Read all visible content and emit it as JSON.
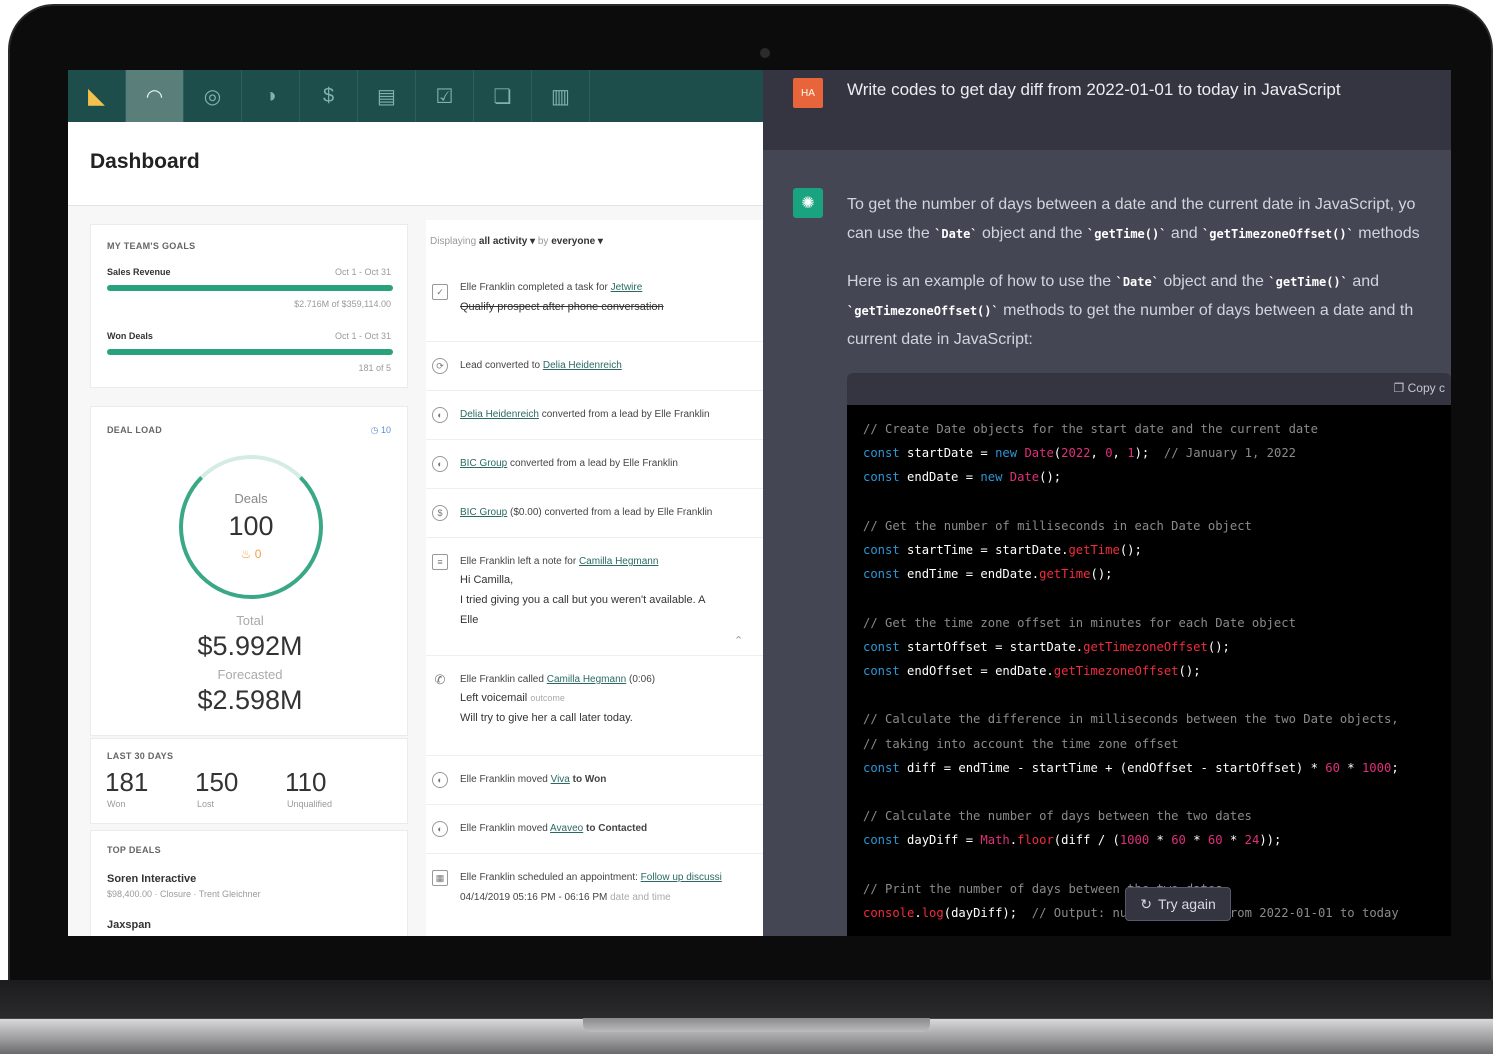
{
  "crm": {
    "title": "Dashboard",
    "goals": {
      "heading": "MY TEAM'S GOALS",
      "items": [
        {
          "label": "Sales Revenue",
          "range": "Oct 1 - Oct 31",
          "detail": "$2.716M of $359,114.00",
          "progress": 1.0
        },
        {
          "label": "Won Deals",
          "range": "Oct 1 - Oct 31",
          "detail": "181 of 5",
          "progress": 1.0
        }
      ]
    },
    "deal_load": {
      "heading": "DEAL LOAD",
      "meta": "10",
      "deals_label": "Deals",
      "deals_value": "100",
      "deals_sub": "0",
      "total_label": "Total",
      "total_value": "$5.992M",
      "forecast_label": "Forecasted",
      "forecast_value": "$2.598M"
    },
    "last30": {
      "heading": "LAST 30 DAYS",
      "stats": [
        {
          "value": "181",
          "label": "Won"
        },
        {
          "value": "150",
          "label": "Lost"
        },
        {
          "value": "110",
          "label": "Unqualified"
        }
      ]
    },
    "top_deals": {
      "heading": "TOP DEALS",
      "items": [
        {
          "name": "Soren Interactive",
          "detail": "$98,400.00 · Closure · Trent Gleichner"
        },
        {
          "name": "Jaxspan",
          "detail": ""
        }
      ]
    },
    "feed": {
      "filter_prefix": "Displaying",
      "filter_activity": "all activity ▾",
      "filter_by": "by",
      "filter_who": "everyone ▾",
      "items": [
        {
          "icon": "✓",
          "text": "Elle Franklin completed a task for",
          "link": "Jetwire",
          "sub": "Qualify prospect after phone conversation"
        },
        {
          "icon": "⟳",
          "text": "Lead converted to",
          "link": "Delia Heidenreich",
          "sub": ""
        },
        {
          "icon": "◐",
          "text": "converted from a lead by Elle Franklin",
          "link": "Delia Heidenreich",
          "sub": ""
        },
        {
          "icon": "◐",
          "text": "converted from a lead by Elle Franklin",
          "link": "BIC Group",
          "sub": ""
        },
        {
          "icon": "$",
          "text": "($0.00) converted from a lead by Elle Franklin",
          "link": "BIC Group",
          "sub": ""
        },
        {
          "icon": "≡",
          "text": "Elle Franklin left a note for",
          "link": "Camilla Hegmann",
          "sub": "Hi Camilla,",
          "sub2": "I tried giving you a call but you weren't available. A",
          "sub3": "Elle"
        },
        {
          "icon": "✆",
          "text": "Elle Franklin called",
          "link": "Camilla Hegmann",
          "extra": "(0:06)",
          "sub": "Left voicemail",
          "sub_tag": "outcome",
          "sub2": "Will try to give her a call later today."
        },
        {
          "icon": "◐",
          "text": "Elle Franklin moved",
          "link": "Viva",
          "extra": "to Won",
          "sub": ""
        },
        {
          "icon": "◐",
          "text": "Elle Franklin moved",
          "link": "Avaveo",
          "extra": "to Contacted",
          "sub": ""
        },
        {
          "icon": "▦",
          "text": "Elle Franklin scheduled an appointment:",
          "link": "Follow up discussi",
          "sub": "04/14/2019 05:16 PM - 06:16 PM",
          "sub_tag": "date and time"
        }
      ]
    }
  },
  "chat": {
    "user_initials": "HA",
    "prompt": "Write codes to get day diff from 2022-01-01 to today in JavaScript",
    "intro": {
      "l1a": "To get the number of days between a date and the current date in JavaScript, yo",
      "l2a": "can use the",
      "c1": "`Date`",
      "l2b": "object and the",
      "c2": "`getTime()`",
      "l2c": "and",
      "c3": "`getTimezoneOffset()`",
      "l2d": "methods"
    },
    "example": {
      "l1a": "Here is an example of how to use the",
      "c1": "`Date`",
      "l1b": "object and the",
      "c2": "`getTime()`",
      "l1c": "and",
      "c3": "`getTimezoneOffset()`",
      "l2b": "methods to get the number of days between a date and th",
      "l3": "current date in JavaScript:"
    },
    "copy_label": "Copy c",
    "try_again": "Try again"
  }
}
